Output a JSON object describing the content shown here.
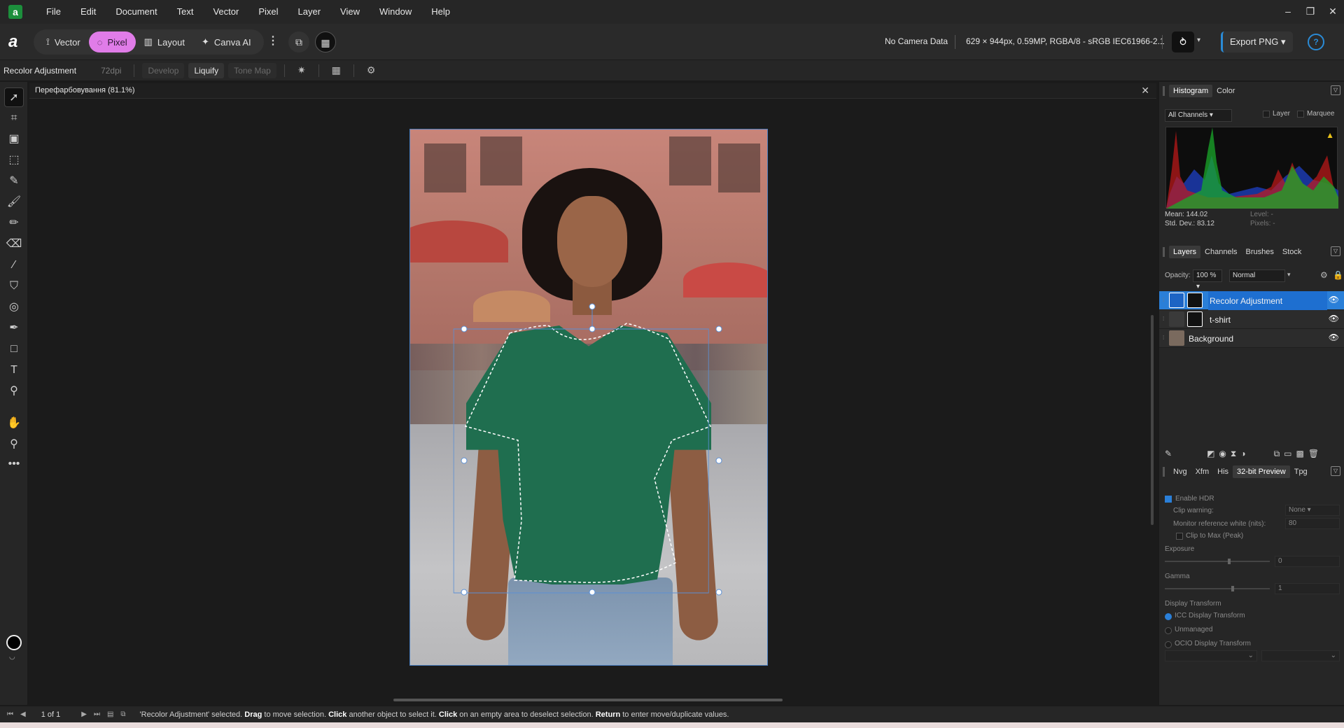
{
  "menu": [
    "File",
    "Edit",
    "Document",
    "Text",
    "Vector",
    "Pixel",
    "Layer",
    "View",
    "Window",
    "Help"
  ],
  "personas": [
    {
      "label": "Vector",
      "icon": "vector-persona-icon"
    },
    {
      "label": "Pixel",
      "icon": "pixel-persona-icon",
      "active": true
    },
    {
      "label": "Layout",
      "icon": "layout-persona-icon"
    },
    {
      "label": "Canva AI",
      "icon": "canva-ai-icon"
    }
  ],
  "toolbar": {
    "camera_data": "No Camera Data",
    "doc_info": "629 × 944px, 0.59MP, RGBA/8 - sRGB IEC61966-2.1",
    "export_label": "Export PNG"
  },
  "context": {
    "title": "Recolor Adjustment",
    "dpi": "72dpi",
    "tabs": [
      {
        "label": "Develop",
        "enabled": false
      },
      {
        "label": "Liquify",
        "enabled": true
      },
      {
        "label": "Tone Map",
        "enabled": false
      }
    ]
  },
  "document": {
    "tab_title": "Перефарбовування (81.1%)",
    "close": "✕"
  },
  "histogram": {
    "tabs": [
      "Histogram",
      "Color"
    ],
    "channel": "All Channels",
    "layer_label": "Layer",
    "marquee_label": "Marquee",
    "mean": "Mean: 144.02",
    "stddev": "Std. Dev.: 83.12",
    "level": "Level: -",
    "pixels": "Pixels: -"
  },
  "layers": {
    "tabs": [
      "Layers",
      "Channels",
      "Brushes",
      "Stock"
    ],
    "opacity_label": "Opacity:",
    "opacity": "100 %",
    "blend": "Normal",
    "items": [
      {
        "name": "Recolor Adjustment",
        "selected": true
      },
      {
        "name": "t-shirt",
        "selected": false
      },
      {
        "name": "Background",
        "selected": false
      }
    ]
  },
  "preview": {
    "tabs": [
      "Nvg",
      "Xfm",
      "His",
      "32-bit Preview",
      "Tpg"
    ],
    "enable_hdr": "Enable HDR",
    "clip_warning": "Clip warning:",
    "clip_value": "None",
    "monitor_white": "Monitor reference white (nits):",
    "monitor_value": "80",
    "clip_max": "Clip to Max (Peak)",
    "exposure": "Exposure",
    "exposure_value": "0",
    "gamma": "Gamma",
    "gamma_value": "1",
    "display_transform": "Display Transform",
    "icc": "ICC Display Transform",
    "unmanaged": "Unmanaged",
    "ocio": "OCIO Display Transform"
  },
  "status": {
    "page": "1 of 1",
    "msg_prefix": "'Recolor Adjustment' selected.",
    "drag": "Drag",
    "msg_drag": "to move selection.",
    "click": "Click",
    "msg_click": "another object to select it.",
    "click2": "Click",
    "msg_click2": "on an empty area to deselect selection.",
    "ret": "Return",
    "msg_ret": "to enter move/duplicate values."
  },
  "colors": {
    "accent": "#2a7fd8",
    "pixel_persona": "#e07ce8",
    "shirt": "#1f6e4f"
  }
}
